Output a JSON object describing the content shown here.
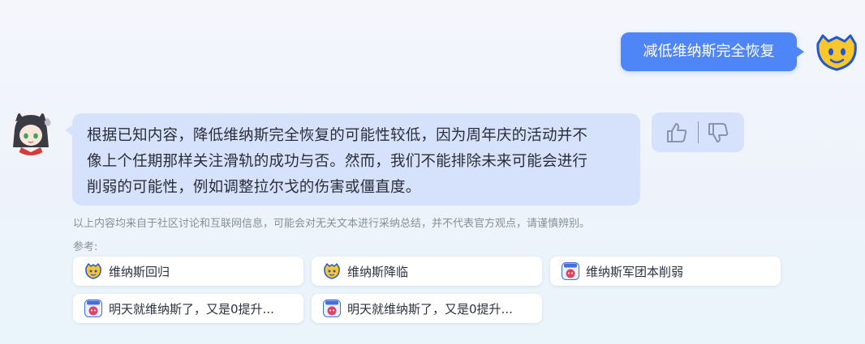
{
  "user_message": {
    "text": "减低维纳斯完全恢复"
  },
  "bot_message": {
    "lines": [
      "根据已知内容，降低维纳斯完全恢复的可能性较低，因为周年庆的活动并不",
      "像上个任期那样关注滑轨的成功与否。然而，我们不能排除未来可能会进行",
      "削弱的可能性，例如调整拉尔戈的伤害或僵直度。"
    ]
  },
  "feedback": {
    "like_icon": "thumbs-up-icon",
    "dislike_icon": "thumbs-down-icon"
  },
  "disclaimer": "以上内容均来自于社区讨论和互联网信息，可能会对无关文本进行采纳总结，并不代表官方观点，请谨慎辨别。",
  "references": {
    "label": "参考:",
    "items": [
      {
        "title": "维纳斯回归",
        "icon": "yellow-cat-icon"
      },
      {
        "title": "维纳斯降临",
        "icon": "yellow-cat-icon"
      },
      {
        "title": "维纳斯军团本削弱",
        "icon": "colg-icon"
      },
      {
        "title": "明天就维纳斯了，又是0提升...",
        "icon": "colg-icon"
      },
      {
        "title": "明天就维纳斯了，又是0提升...",
        "icon": "colg-icon"
      }
    ]
  },
  "colors": {
    "user_bubble": "#4f86f7",
    "bot_bubble": "#d6e1fb",
    "background": "#eef3fb"
  }
}
